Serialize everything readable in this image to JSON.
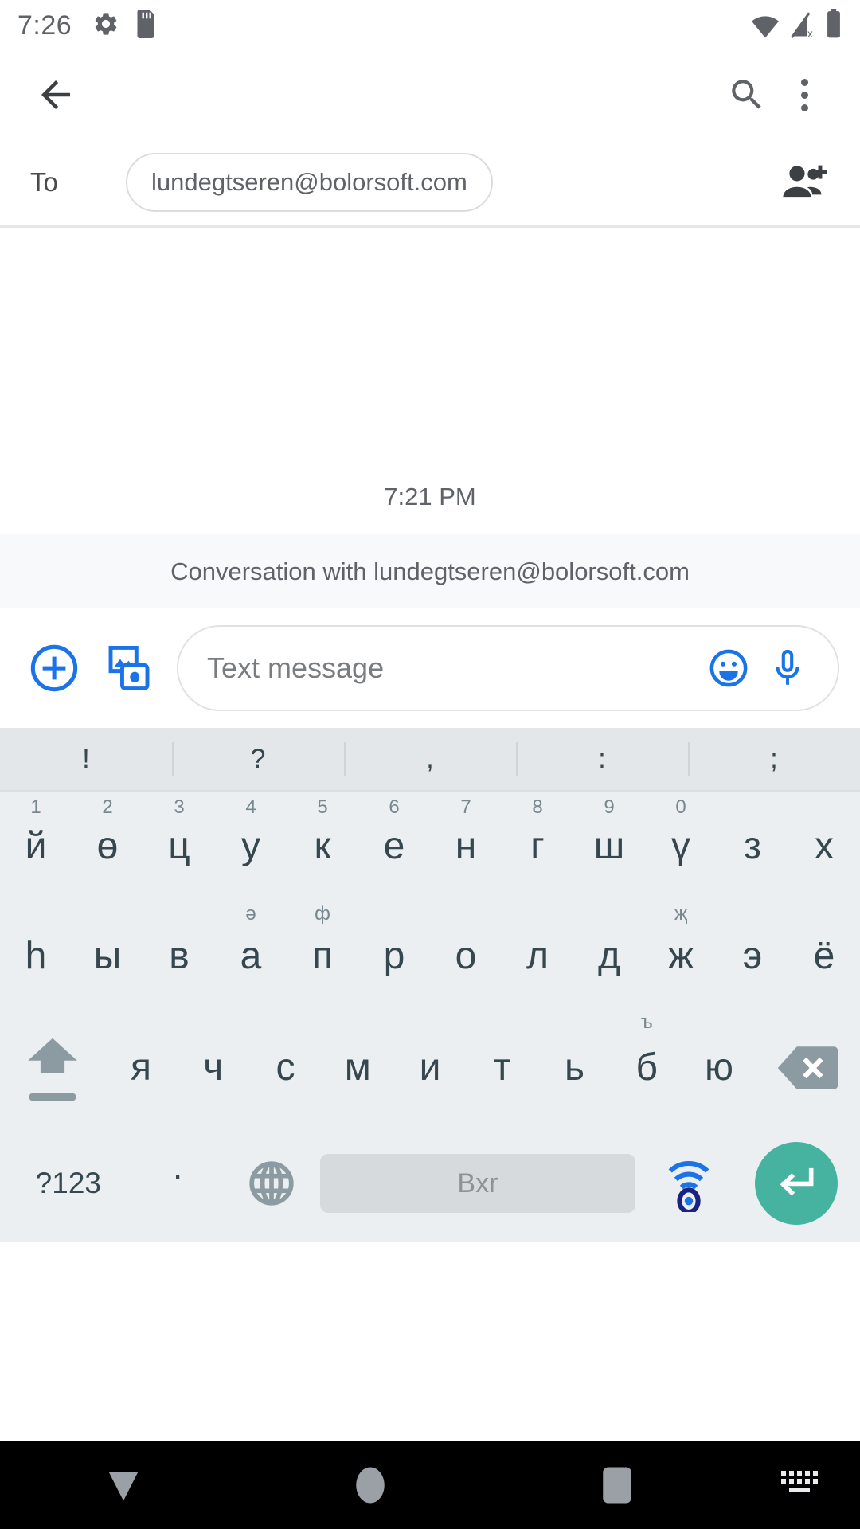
{
  "status_bar": {
    "clock": "7:26",
    "left_icons": [
      "gear-icon",
      "sd-card-icon"
    ],
    "right_icons": [
      "wifi-icon",
      "signal-off-icon",
      "battery-icon"
    ]
  },
  "toolbar": {
    "back_icon": "back-arrow-icon",
    "search_icon": "search-icon",
    "overflow_icon": "overflow-menu-icon"
  },
  "recipient": {
    "to_label": "To",
    "chip_value": "lundegtseren@bolorsoft.com",
    "add_contact_icon": "add-person-icon"
  },
  "conversation": {
    "timestamp": "7:21 PM",
    "banner": "Conversation with lundegtseren@bolorsoft.com"
  },
  "compose": {
    "attach_icon": "plus-circle-icon",
    "media_icon": "image-camera-icon",
    "placeholder": "Text message",
    "value": "",
    "emoji_icon": "emoji-icon",
    "mic_icon": "microphone-icon",
    "accent_color": "#1a73e8"
  },
  "keyboard": {
    "suggestions": [
      "!",
      "?",
      ",",
      ":",
      ";"
    ],
    "row1": [
      {
        "main": "й",
        "sup": "1"
      },
      {
        "main": "ө",
        "sup": "2"
      },
      {
        "main": "ц",
        "sup": "3"
      },
      {
        "main": "у",
        "sup": "4"
      },
      {
        "main": "к",
        "sup": "5"
      },
      {
        "main": "е",
        "sup": "6"
      },
      {
        "main": "н",
        "sup": "7"
      },
      {
        "main": "г",
        "sup": "8"
      },
      {
        "main": "ш",
        "sup": "9"
      },
      {
        "main": "ү",
        "sup": "0"
      },
      {
        "main": "з",
        "sup": ""
      },
      {
        "main": "х",
        "sup": ""
      }
    ],
    "row2": [
      {
        "main": "һ",
        "sup": ""
      },
      {
        "main": "ы",
        "sup": ""
      },
      {
        "main": "в",
        "sup": ""
      },
      {
        "main": "а",
        "sup": "ә"
      },
      {
        "main": "п",
        "sup": "ф"
      },
      {
        "main": "р",
        "sup": ""
      },
      {
        "main": "о",
        "sup": ""
      },
      {
        "main": "л",
        "sup": ""
      },
      {
        "main": "д",
        "sup": ""
      },
      {
        "main": "ж",
        "sup": "җ"
      },
      {
        "main": "э",
        "sup": ""
      },
      {
        "main": "ё",
        "sup": ""
      }
    ],
    "row3": {
      "shift_icon": "shift-icon",
      "keys": [
        {
          "main": "я",
          "sup": ""
        },
        {
          "main": "ч",
          "sup": ""
        },
        {
          "main": "с",
          "sup": ""
        },
        {
          "main": "м",
          "sup": ""
        },
        {
          "main": "и",
          "sup": ""
        },
        {
          "main": "т",
          "sup": ""
        },
        {
          "main": "ь",
          "sup": ""
        },
        {
          "main": "б",
          "sup": "ъ"
        },
        {
          "main": "ю",
          "sup": ""
        }
      ],
      "backspace_icon": "backspace-icon"
    },
    "row4": {
      "symbols_label": "?123",
      "period_label": ".",
      "globe_icon": "globe-icon",
      "space_label": "Bxr",
      "voice_icon": "voice-input-icon",
      "enter_icon": "enter-icon",
      "enter_color": "#45b3a0"
    }
  },
  "nav_bar": {
    "back_icon": "hide-keyboard-icon",
    "home_icon": "home-icon",
    "recents_icon": "recents-icon",
    "keyboard_icon": "keyboard-switcher-icon"
  }
}
